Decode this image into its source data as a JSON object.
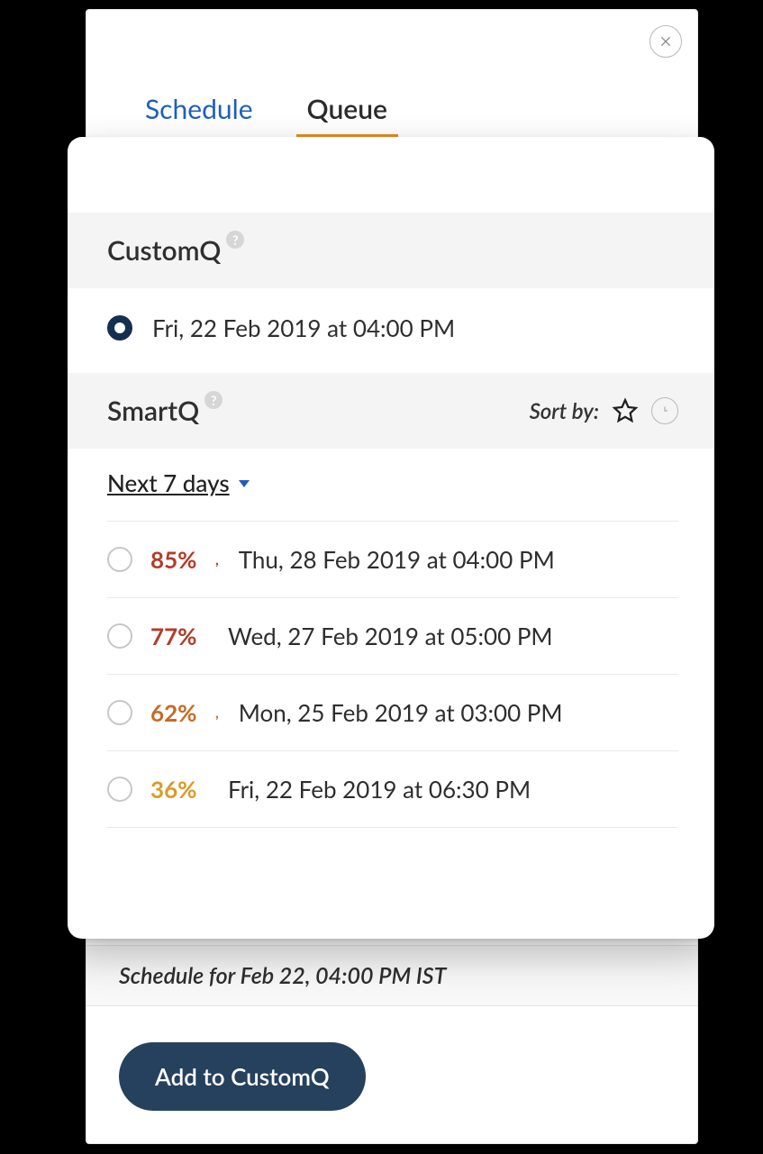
{
  "tabs": {
    "schedule": "Schedule",
    "queue": "Queue",
    "active": "queue"
  },
  "close_label": "Close",
  "customq": {
    "title": "CustomQ",
    "slot": "Fri, 22 Feb 2019 at 04:00 PM",
    "selected": true
  },
  "smartq": {
    "title": "SmartQ",
    "sort_label": "Sort by:",
    "range": "Next 7 days",
    "slots": [
      {
        "pct": "85%",
        "color": "#b23c2a",
        "has_comma": true,
        "date": "Thu, 28 Feb 2019 at 04:00 PM"
      },
      {
        "pct": "77%",
        "color": "#b23c2a",
        "has_comma": false,
        "date": "Wed, 27 Feb 2019 at 05:00 PM"
      },
      {
        "pct": "62%",
        "color": "#c86a24",
        "has_comma": true,
        "date": "Mon, 25 Feb 2019 at 03:00 PM"
      },
      {
        "pct": "36%",
        "color": "#d99a28",
        "has_comma": false,
        "date": "Fri, 22 Feb 2019 at 06:30 PM"
      }
    ]
  },
  "footer": {
    "schedule_for": "Schedule for Feb 22, 04:00 PM  IST"
  },
  "primary_action": "Add to CustomQ"
}
